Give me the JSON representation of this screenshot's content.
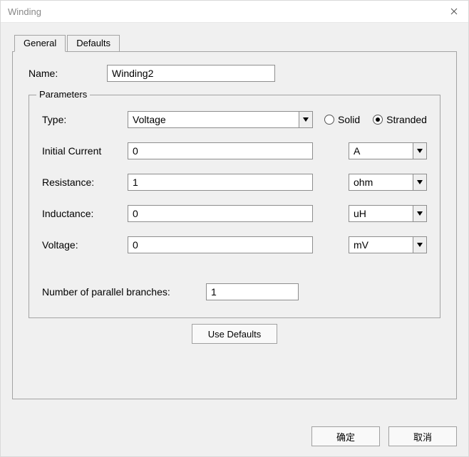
{
  "title": "Winding",
  "tabs": {
    "general": "General",
    "defaults": "Defaults"
  },
  "name_label": "Name:",
  "name_value": "Winding2",
  "parameters_legend": "Parameters",
  "type_label": "Type:",
  "type_value": "Voltage",
  "radio_solid": "Solid",
  "radio_stranded": "Stranded",
  "initial_current_label": "Initial Current",
  "initial_current_value": "0",
  "initial_current_unit": "A",
  "resistance_label": "Resistance:",
  "resistance_value": "1",
  "resistance_unit": "ohm",
  "inductance_label": "Inductance:",
  "inductance_value": "0",
  "inductance_unit": "uH",
  "voltage_label": "Voltage:",
  "voltage_value": "0",
  "voltage_unit": "mV",
  "parallel_label": "Number of parallel branches:",
  "parallel_value": "1",
  "use_defaults": "Use Defaults",
  "ok": "确定",
  "cancel": "取消"
}
